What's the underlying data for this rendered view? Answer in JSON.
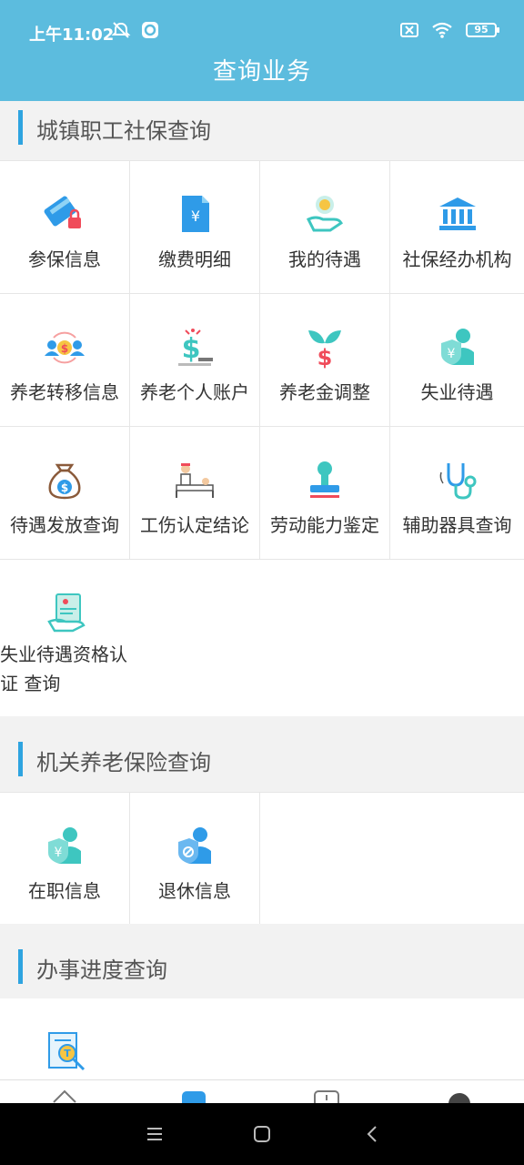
{
  "status": {
    "time": "上午11:02",
    "battery": "95"
  },
  "header": {
    "title": "查询业务"
  },
  "sections": {
    "urban": {
      "title": "城镇职工社保查询"
    },
    "gov": {
      "title": "机关养老保险查询"
    },
    "progress": {
      "title": "办事进度查询"
    }
  },
  "urban_items": [
    {
      "label": "参保信息",
      "icon": "card-lock-icon"
    },
    {
      "label": "缴费明细",
      "icon": "yuan-document-icon"
    },
    {
      "label": "我的待遇",
      "icon": "hand-coin-icon"
    },
    {
      "label": "社保经办机构",
      "icon": "bank-building-icon"
    },
    {
      "label": "养老转移信息",
      "icon": "people-transfer-icon"
    },
    {
      "label": "养老个人账户",
      "icon": "dollar-account-icon"
    },
    {
      "label": "养老金调整",
      "icon": "dollar-plant-icon"
    },
    {
      "label": "失业待遇",
      "icon": "shield-person-icon"
    },
    {
      "label": "待遇发放查询",
      "icon": "money-bag-icon"
    },
    {
      "label": "工伤认定结论",
      "icon": "hospital-bed-icon"
    },
    {
      "label": "劳动能力鉴定",
      "icon": "stamp-icon"
    },
    {
      "label": "辅助器具查询",
      "icon": "stethoscope-icon"
    },
    {
      "label": "失业待遇资格认证 查询",
      "icon": "certificate-hand-icon"
    }
  ],
  "gov_items": [
    {
      "label": "在职信息",
      "icon": "shield-person-icon"
    },
    {
      "label": "退休信息",
      "icon": "shield-person-retired-icon"
    }
  ],
  "progress_items": [
    {
      "label": "",
      "icon": "document-search-icon"
    }
  ],
  "colors": {
    "header_bg": "#5cbcde",
    "accent": "#2fa4e0",
    "teal": "#3ec6c0",
    "blue": "#2f9be8",
    "red": "#f04b5a"
  }
}
